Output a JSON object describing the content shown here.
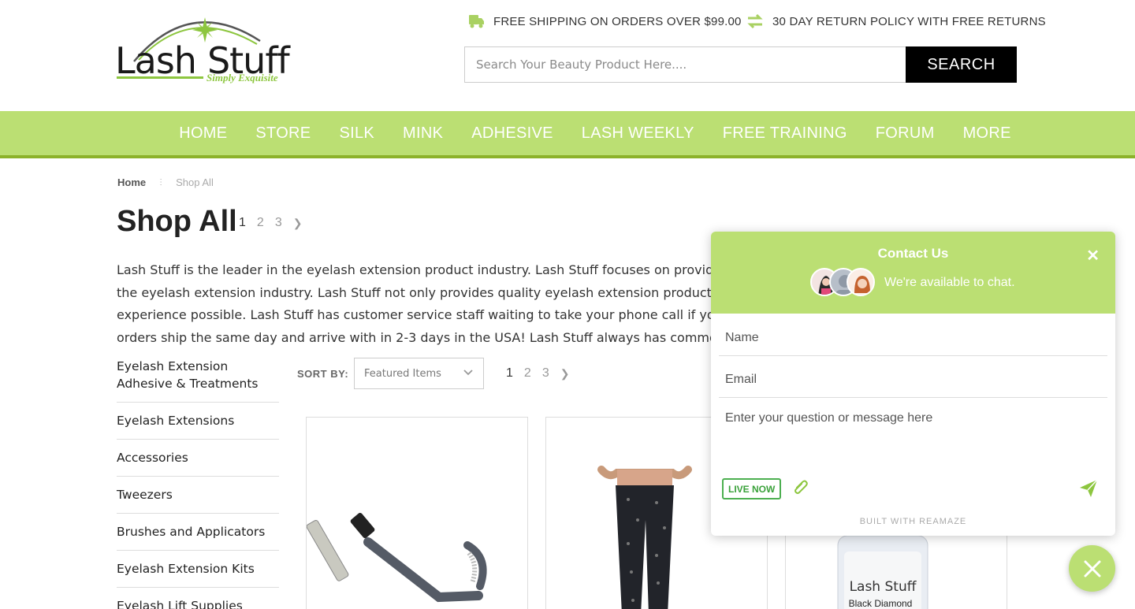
{
  "brand": {
    "logo_left": "Lash",
    "logo_right": "Stuff",
    "tagline": "Simply Exquisite",
    "accent_color": "#bbdf73",
    "accent_dark": "#8cb22a"
  },
  "promos": {
    "shipping": {
      "icon": "truck-icon",
      "text": "FREE SHIPPING ON ORDERS OVER $99.00"
    },
    "returns": {
      "icon": "exchange-arrows-icon",
      "text": "30 DAY RETURN POLICY WITH FREE RETURNS"
    }
  },
  "search": {
    "placeholder": "Search Your Beauty Product Here....",
    "button_label": "SEARCH"
  },
  "nav": {
    "items": [
      "HOME",
      "STORE",
      "SILK",
      "MINK",
      "ADHESIVE",
      "LASH WEEKLY",
      "FREE TRAINING",
      "FORUM",
      "MORE"
    ]
  },
  "breadcrumb": {
    "home": "Home",
    "current": "Shop All"
  },
  "page": {
    "title": "Shop All",
    "pages": [
      "1",
      "2",
      "3"
    ],
    "current_page": "1",
    "intro_lines": [
      "Lash Stuff is the leader in the eyelash extension product industry.  Lash Stuff focuses on providing qu",
      "the eyelash extension industry.  Lash Stuff not only provides quality eyelash extension products but w",
      "experience possible.  Lash Stuff has customer service staff waiting to take your phone call if you have",
      "orders ship the same day and arrive with in 2-3 days in the USA! Lash Stuff always has common sizes"
    ]
  },
  "sidebar": {
    "categories": [
      "Eyelash Extension Adhesive & Treatments",
      "Eyelash Extensions",
      "Accessories",
      "Tweezers",
      "Brushes and Applicators",
      "Eyelash Extension Kits",
      "Eyelash Lift Supplies"
    ]
  },
  "sort": {
    "label": "SORT BY:",
    "selected": "Featured Items"
  },
  "products": [
    {
      "image": "folding-mascara-wand"
    },
    {
      "image": "patterned-leggings"
    },
    {
      "image": "adhesive-bottle",
      "bottle_label_1": "Lash Stuff",
      "bottle_label_2": "Black Diamond"
    }
  ],
  "chat": {
    "title": "Contact Us",
    "availability": "We're available to chat.",
    "name_placeholder": "Name",
    "email_placeholder": "Email",
    "message_placeholder": "Enter your question or message here",
    "live_badge": "LIVE NOW",
    "footer": "BUILT WITH REAMAZE"
  }
}
